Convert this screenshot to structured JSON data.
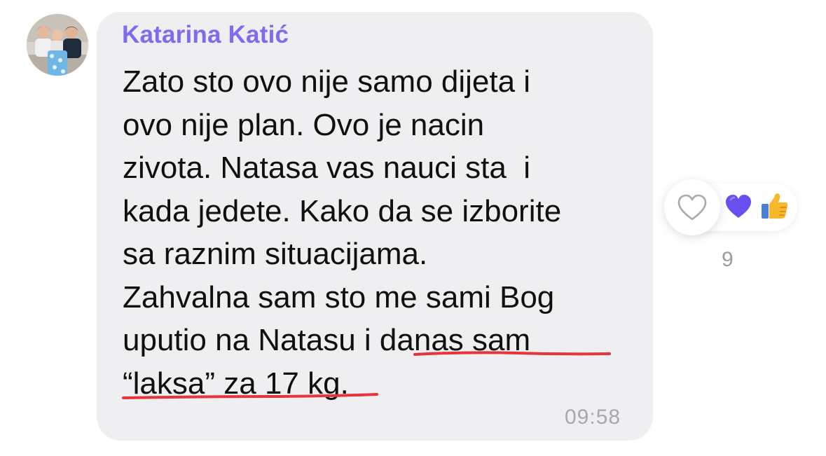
{
  "message": {
    "sender": "Katarina Katić",
    "lines": [
      "Zato sto ovo nije samo dijeta i",
      "ovo nije plan. Ovo je nacin",
      "zivota. Natasa vas nauci sta  i",
      "kada jedete. Kako da se izborite",
      "sa raznim situacijama.",
      "Zahvalna sam sto me sami Bog",
      "uputio na Natasu i danas sam",
      "“laksa” za 17 kg."
    ],
    "time": "09:58"
  },
  "reactions": {
    "count": "9",
    "icons": [
      "heart-outline-icon",
      "purple-heart-icon",
      "thumbs-up-icon"
    ]
  },
  "colors": {
    "sender": "#7e6bf0",
    "bubble": "#efeff1",
    "underline": "#e8333a",
    "purple_heart": "#6a4ff0",
    "thumbs_up": "#f7b82c"
  }
}
